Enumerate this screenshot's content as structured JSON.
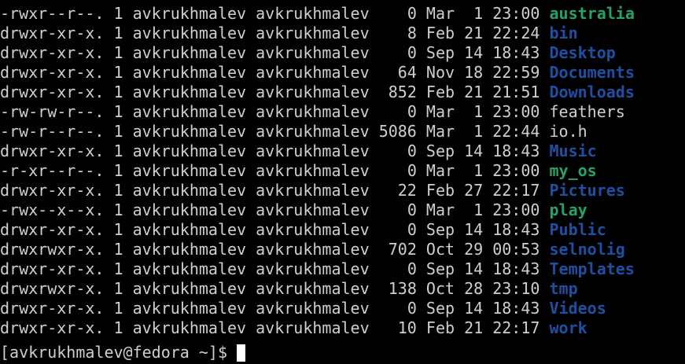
{
  "terminal": {
    "listing": [
      {
        "perms": "-rwxr--r--.",
        "links": "1",
        "owner": "avkrukhmalev",
        "group": "avkrukhmalev",
        "size": "0",
        "month": "Mar",
        "day": "1",
        "time": "23:00",
        "name": "australia",
        "kind": "exec"
      },
      {
        "perms": "drwxr-xr-x.",
        "links": "1",
        "owner": "avkrukhmalev",
        "group": "avkrukhmalev",
        "size": "8",
        "month": "Feb",
        "day": "21",
        "time": "22:24",
        "name": "bin",
        "kind": "dir"
      },
      {
        "perms": "drwxr-xr-x.",
        "links": "1",
        "owner": "avkrukhmalev",
        "group": "avkrukhmalev",
        "size": "0",
        "month": "Sep",
        "day": "14",
        "time": "18:43",
        "name": "Desktop",
        "kind": "dir"
      },
      {
        "perms": "drwxr-xr-x.",
        "links": "1",
        "owner": "avkrukhmalev",
        "group": "avkrukhmalev",
        "size": "64",
        "month": "Nov",
        "day": "18",
        "time": "22:59",
        "name": "Documents",
        "kind": "dir"
      },
      {
        "perms": "drwxr-xr-x.",
        "links": "1",
        "owner": "avkrukhmalev",
        "group": "avkrukhmalev",
        "size": "852",
        "month": "Feb",
        "day": "21",
        "time": "21:51",
        "name": "Downloads",
        "kind": "dir"
      },
      {
        "perms": "-rw-rw-r--.",
        "links": "1",
        "owner": "avkrukhmalev",
        "group": "avkrukhmalev",
        "size": "0",
        "month": "Mar",
        "day": "1",
        "time": "23:00",
        "name": "feathers",
        "kind": "plain"
      },
      {
        "perms": "-rw-r--r--.",
        "links": "1",
        "owner": "avkrukhmalev",
        "group": "avkrukhmalev",
        "size": "5086",
        "month": "Mar",
        "day": "1",
        "time": "22:44",
        "name": "io.h",
        "kind": "plain"
      },
      {
        "perms": "drwxr-xr-x.",
        "links": "1",
        "owner": "avkrukhmalev",
        "group": "avkrukhmalev",
        "size": "0",
        "month": "Sep",
        "day": "14",
        "time": "18:43",
        "name": "Music",
        "kind": "dir"
      },
      {
        "perms": "-r-xr--r--.",
        "links": "1",
        "owner": "avkrukhmalev",
        "group": "avkrukhmalev",
        "size": "0",
        "month": "Mar",
        "day": "1",
        "time": "23:00",
        "name": "my_os",
        "kind": "exec"
      },
      {
        "perms": "drwxr-xr-x.",
        "links": "1",
        "owner": "avkrukhmalev",
        "group": "avkrukhmalev",
        "size": "22",
        "month": "Feb",
        "day": "27",
        "time": "22:17",
        "name": "Pictures",
        "kind": "dir"
      },
      {
        "perms": "-rwx--x--x.",
        "links": "1",
        "owner": "avkrukhmalev",
        "group": "avkrukhmalev",
        "size": "0",
        "month": "Mar",
        "day": "1",
        "time": "23:00",
        "name": "play",
        "kind": "exec"
      },
      {
        "perms": "drwxr-xr-x.",
        "links": "1",
        "owner": "avkrukhmalev",
        "group": "avkrukhmalev",
        "size": "0",
        "month": "Sep",
        "day": "14",
        "time": "18:43",
        "name": "Public",
        "kind": "dir"
      },
      {
        "perms": "drwxrwxr-x.",
        "links": "1",
        "owner": "avkrukhmalev",
        "group": "avkrukhmalev",
        "size": "702",
        "month": "Oct",
        "day": "29",
        "time": "00:53",
        "name": "selnolig",
        "kind": "dir"
      },
      {
        "perms": "drwxr-xr-x.",
        "links": "1",
        "owner": "avkrukhmalev",
        "group": "avkrukhmalev",
        "size": "0",
        "month": "Sep",
        "day": "14",
        "time": "18:43",
        "name": "Templates",
        "kind": "dir"
      },
      {
        "perms": "drwxrwxr-x.",
        "links": "1",
        "owner": "avkrukhmalev",
        "group": "avkrukhmalev",
        "size": "138",
        "month": "Oct",
        "day": "28",
        "time": "23:10",
        "name": "tmp",
        "kind": "dir"
      },
      {
        "perms": "drwxr-xr-x.",
        "links": "1",
        "owner": "avkrukhmalev",
        "group": "avkrukhmalev",
        "size": "0",
        "month": "Sep",
        "day": "14",
        "time": "18:43",
        "name": "Videos",
        "kind": "dir"
      },
      {
        "perms": "drwxr-xr-x.",
        "links": "1",
        "owner": "avkrukhmalev",
        "group": "avkrukhmalev",
        "size": "10",
        "month": "Feb",
        "day": "21",
        "time": "22:17",
        "name": "work",
        "kind": "dir"
      }
    ],
    "prompt": "[avkrukhmalev@fedora ~]$"
  },
  "colors": {
    "background": "#000000",
    "text": "#d0cfcc",
    "directory": "#1f4fa3",
    "executable": "#26a269",
    "cursor": "#ffffff"
  }
}
